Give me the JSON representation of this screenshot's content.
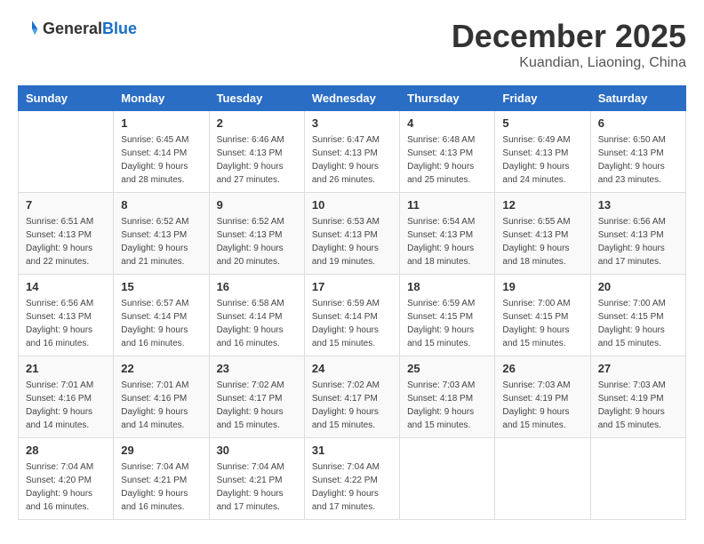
{
  "header": {
    "logo_general": "General",
    "logo_blue": "Blue",
    "month": "December 2025",
    "location": "Kuandian, Liaoning, China"
  },
  "weekdays": [
    "Sunday",
    "Monday",
    "Tuesday",
    "Wednesday",
    "Thursday",
    "Friday",
    "Saturday"
  ],
  "weeks": [
    [
      {
        "day": "",
        "sunrise": "",
        "sunset": "",
        "daylight": ""
      },
      {
        "day": "1",
        "sunrise": "Sunrise: 6:45 AM",
        "sunset": "Sunset: 4:14 PM",
        "daylight": "Daylight: 9 hours and 28 minutes."
      },
      {
        "day": "2",
        "sunrise": "Sunrise: 6:46 AM",
        "sunset": "Sunset: 4:13 PM",
        "daylight": "Daylight: 9 hours and 27 minutes."
      },
      {
        "day": "3",
        "sunrise": "Sunrise: 6:47 AM",
        "sunset": "Sunset: 4:13 PM",
        "daylight": "Daylight: 9 hours and 26 minutes."
      },
      {
        "day": "4",
        "sunrise": "Sunrise: 6:48 AM",
        "sunset": "Sunset: 4:13 PM",
        "daylight": "Daylight: 9 hours and 25 minutes."
      },
      {
        "day": "5",
        "sunrise": "Sunrise: 6:49 AM",
        "sunset": "Sunset: 4:13 PM",
        "daylight": "Daylight: 9 hours and 24 minutes."
      },
      {
        "day": "6",
        "sunrise": "Sunrise: 6:50 AM",
        "sunset": "Sunset: 4:13 PM",
        "daylight": "Daylight: 9 hours and 23 minutes."
      }
    ],
    [
      {
        "day": "7",
        "sunrise": "Sunrise: 6:51 AM",
        "sunset": "Sunset: 4:13 PM",
        "daylight": "Daylight: 9 hours and 22 minutes."
      },
      {
        "day": "8",
        "sunrise": "Sunrise: 6:52 AM",
        "sunset": "Sunset: 4:13 PM",
        "daylight": "Daylight: 9 hours and 21 minutes."
      },
      {
        "day": "9",
        "sunrise": "Sunrise: 6:52 AM",
        "sunset": "Sunset: 4:13 PM",
        "daylight": "Daylight: 9 hours and 20 minutes."
      },
      {
        "day": "10",
        "sunrise": "Sunrise: 6:53 AM",
        "sunset": "Sunset: 4:13 PM",
        "daylight": "Daylight: 9 hours and 19 minutes."
      },
      {
        "day": "11",
        "sunrise": "Sunrise: 6:54 AM",
        "sunset": "Sunset: 4:13 PM",
        "daylight": "Daylight: 9 hours and 18 minutes."
      },
      {
        "day": "12",
        "sunrise": "Sunrise: 6:55 AM",
        "sunset": "Sunset: 4:13 PM",
        "daylight": "Daylight: 9 hours and 18 minutes."
      },
      {
        "day": "13",
        "sunrise": "Sunrise: 6:56 AM",
        "sunset": "Sunset: 4:13 PM",
        "daylight": "Daylight: 9 hours and 17 minutes."
      }
    ],
    [
      {
        "day": "14",
        "sunrise": "Sunrise: 6:56 AM",
        "sunset": "Sunset: 4:13 PM",
        "daylight": "Daylight: 9 hours and 16 minutes."
      },
      {
        "day": "15",
        "sunrise": "Sunrise: 6:57 AM",
        "sunset": "Sunset: 4:14 PM",
        "daylight": "Daylight: 9 hours and 16 minutes."
      },
      {
        "day": "16",
        "sunrise": "Sunrise: 6:58 AM",
        "sunset": "Sunset: 4:14 PM",
        "daylight": "Daylight: 9 hours and 16 minutes."
      },
      {
        "day": "17",
        "sunrise": "Sunrise: 6:59 AM",
        "sunset": "Sunset: 4:14 PM",
        "daylight": "Daylight: 9 hours and 15 minutes."
      },
      {
        "day": "18",
        "sunrise": "Sunrise: 6:59 AM",
        "sunset": "Sunset: 4:15 PM",
        "daylight": "Daylight: 9 hours and 15 minutes."
      },
      {
        "day": "19",
        "sunrise": "Sunrise: 7:00 AM",
        "sunset": "Sunset: 4:15 PM",
        "daylight": "Daylight: 9 hours and 15 minutes."
      },
      {
        "day": "20",
        "sunrise": "Sunrise: 7:00 AM",
        "sunset": "Sunset: 4:15 PM",
        "daylight": "Daylight: 9 hours and 15 minutes."
      }
    ],
    [
      {
        "day": "21",
        "sunrise": "Sunrise: 7:01 AM",
        "sunset": "Sunset: 4:16 PM",
        "daylight": "Daylight: 9 hours and 14 minutes."
      },
      {
        "day": "22",
        "sunrise": "Sunrise: 7:01 AM",
        "sunset": "Sunset: 4:16 PM",
        "daylight": "Daylight: 9 hours and 14 minutes."
      },
      {
        "day": "23",
        "sunrise": "Sunrise: 7:02 AM",
        "sunset": "Sunset: 4:17 PM",
        "daylight": "Daylight: 9 hours and 15 minutes."
      },
      {
        "day": "24",
        "sunrise": "Sunrise: 7:02 AM",
        "sunset": "Sunset: 4:17 PM",
        "daylight": "Daylight: 9 hours and 15 minutes."
      },
      {
        "day": "25",
        "sunrise": "Sunrise: 7:03 AM",
        "sunset": "Sunset: 4:18 PM",
        "daylight": "Daylight: 9 hours and 15 minutes."
      },
      {
        "day": "26",
        "sunrise": "Sunrise: 7:03 AM",
        "sunset": "Sunset: 4:19 PM",
        "daylight": "Daylight: 9 hours and 15 minutes."
      },
      {
        "day": "27",
        "sunrise": "Sunrise: 7:03 AM",
        "sunset": "Sunset: 4:19 PM",
        "daylight": "Daylight: 9 hours and 15 minutes."
      }
    ],
    [
      {
        "day": "28",
        "sunrise": "Sunrise: 7:04 AM",
        "sunset": "Sunset: 4:20 PM",
        "daylight": "Daylight: 9 hours and 16 minutes."
      },
      {
        "day": "29",
        "sunrise": "Sunrise: 7:04 AM",
        "sunset": "Sunset: 4:21 PM",
        "daylight": "Daylight: 9 hours and 16 minutes."
      },
      {
        "day": "30",
        "sunrise": "Sunrise: 7:04 AM",
        "sunset": "Sunset: 4:21 PM",
        "daylight": "Daylight: 9 hours and 17 minutes."
      },
      {
        "day": "31",
        "sunrise": "Sunrise: 7:04 AM",
        "sunset": "Sunset: 4:22 PM",
        "daylight": "Daylight: 9 hours and 17 minutes."
      },
      {
        "day": "",
        "sunrise": "",
        "sunset": "",
        "daylight": ""
      },
      {
        "day": "",
        "sunrise": "",
        "sunset": "",
        "daylight": ""
      },
      {
        "day": "",
        "sunrise": "",
        "sunset": "",
        "daylight": ""
      }
    ]
  ]
}
